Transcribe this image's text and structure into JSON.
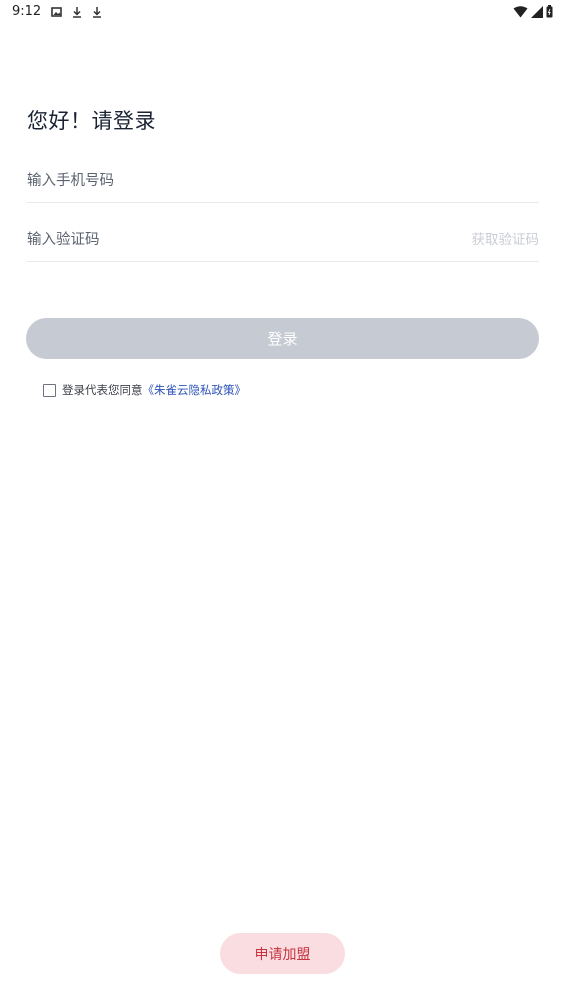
{
  "status_bar": {
    "time": "9:12",
    "left_icons": [
      "photo-icon",
      "download-icon",
      "download-icon"
    ],
    "right_icons": [
      "wifi-icon",
      "signal-icon",
      "battery-icon"
    ]
  },
  "login": {
    "greeting": "您好！请登录",
    "phone_placeholder": "输入手机号码",
    "code_placeholder": "输入验证码",
    "get_code_label": "获取验证码",
    "login_label": "登录",
    "login_button_color": "#c6cad3"
  },
  "agreement": {
    "prefix": "登录代表您同意",
    "policy_link": "《朱雀云隐私政策》",
    "checked": false,
    "link_color": "#2b52b8"
  },
  "join": {
    "label": "申请加盟",
    "background": "#f9dde1",
    "text_color": "#c8333f"
  }
}
